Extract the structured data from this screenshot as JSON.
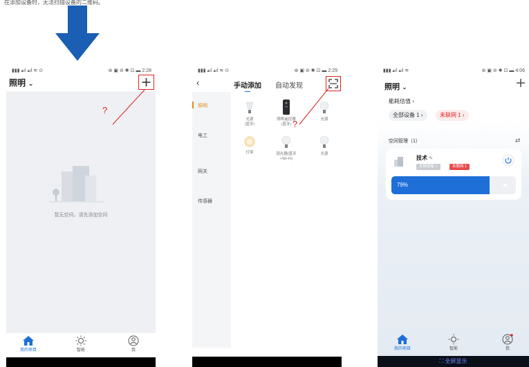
{
  "caption": "在添加设备时，无法扫描设备的二维码。",
  "colors": {
    "accent": "#1f6fd8",
    "red": "#e02020",
    "arrow": "#1a5fb4",
    "bg_gray": "#eef0f3"
  },
  "annotation": {
    "question_mark": "?"
  },
  "screen1": {
    "status_left": "▮▮▮ ▴ıl ▴ıl ≋ ⊙",
    "status_right": "⊛ ▣ ⊘ ✱ ⊡ ▬ 2:28",
    "header_title": "照明",
    "header_caret": "⌄",
    "add_icon": "plus-icon",
    "empty_text": "暂无空间，请先添加空间",
    "nav": [
      {
        "label": "我的项目",
        "icon": "home-icon"
      },
      {
        "label": "智能",
        "icon": "sun-icon"
      },
      {
        "label": "我",
        "icon": "user-icon"
      }
    ]
  },
  "screen2": {
    "status_left": "▮▮▮ ▴ıl ▴ıl ≋ ⊙",
    "status_right": "⊛ ▣ ⊘ ✱ ⊡ ▬ 2:29",
    "back_icon": "back-chevron-icon",
    "tabs": [
      "手动添加",
      "自动发现"
    ],
    "scan_icon": "scan-icon",
    "categories": [
      "照明",
      "电工",
      "网关",
      "传感器"
    ],
    "devices": [
      {
        "name": "光源\n(蓝牙)",
        "icon": "bulb-icon"
      },
      {
        "name": "照明遥控器\n(蓝牙)",
        "icon": "remote-icon"
      },
      {
        "name": "光源",
        "icon": "bulb-icon"
      },
      {
        "name": "灯带",
        "icon": "light-strip-icon"
      },
      {
        "name": "调光器(蓝牙\n+Wi-Fi)",
        "icon": "bulb-icon"
      },
      {
        "name": "光源",
        "icon": "bulb-icon"
      }
    ]
  },
  "screen3": {
    "status_left": "▮▮▮ ▴ıl ▴ıl ≋",
    "status_right": "⊛ ▣ ⊘ ✱ ⊡ ▬ 4:06",
    "header_title": "照明",
    "header_caret": "⌄",
    "add_icon": "plus-icon",
    "energy_label": "能耗估值 ›",
    "chip_all": "全部设备 1 ›",
    "chip_offline": "未联网 1 ›",
    "space_mgmt": "空间管理（1）",
    "swap_icon": "swap-icon",
    "room_name": "技术",
    "room_edit": "✎",
    "room_badge_all": "全部设备 1",
    "room_badge_offline": "未联网 1",
    "power_icon": "power-icon",
    "brightness": 0.79,
    "brightness_text": "79%",
    "nav": [
      {
        "label": "我的项目",
        "icon": "home-icon"
      },
      {
        "label": "智能",
        "icon": "sun-icon"
      },
      {
        "label": "我",
        "icon": "user-icon"
      }
    ],
    "fullscreen_label": "⛶ 全屏显示"
  }
}
